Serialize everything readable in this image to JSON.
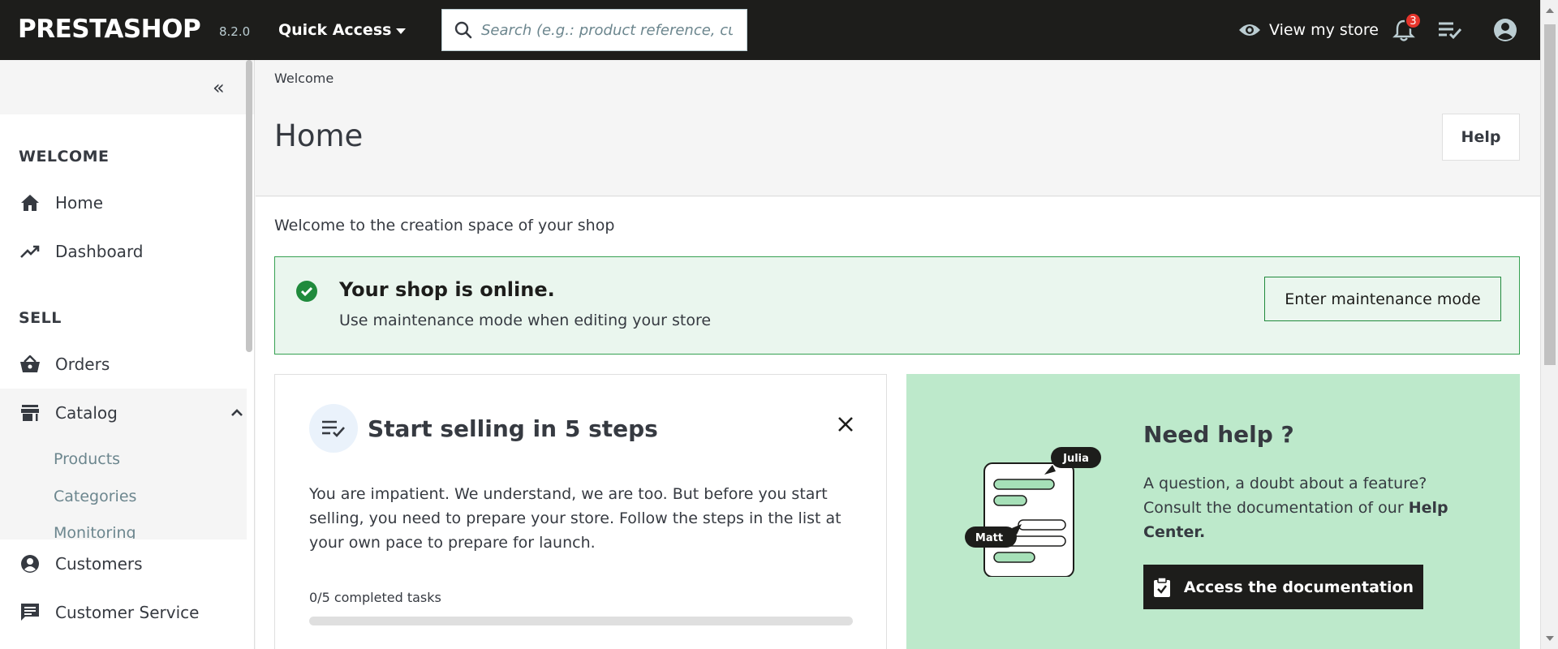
{
  "topbar": {
    "logo": "PRESTASHOP",
    "version": "8.2.0",
    "quick_access": "Quick Access",
    "search_placeholder": "Search (e.g.: product reference, custon",
    "view_store": "View my store",
    "notifications_count": "3"
  },
  "sidebar": {
    "sections": [
      {
        "title": "WELCOME"
      },
      {
        "title": "SELL"
      }
    ],
    "items": [
      {
        "label": "Home",
        "icon": "home-icon"
      },
      {
        "label": "Dashboard",
        "icon": "trending-up-icon"
      },
      {
        "label": "Orders",
        "icon": "basket-icon"
      },
      {
        "label": "Catalog",
        "icon": "store-icon"
      },
      {
        "label": "Customers",
        "icon": "account-circle-icon"
      },
      {
        "label": "Customer Service",
        "icon": "chat-icon"
      }
    ],
    "catalog_sub": [
      "Products",
      "Categories",
      "Monitoring"
    ]
  },
  "header": {
    "breadcrumb": "Welcome",
    "title": "Home",
    "help_button": "Help"
  },
  "content": {
    "welcome_text": "Welcome to the creation space of your shop",
    "online": {
      "title": "Your shop is online.",
      "subtitle": "Use maintenance mode when editing your store",
      "button": "Enter maintenance mode"
    },
    "steps": {
      "title": "Start selling in 5 steps",
      "description": "You are impatient. We understand, we are too. But before you start selling, you need to prepare your store. Follow the steps in the list at your own pace to prepare for launch.",
      "progress_label": "0/5 completed tasks",
      "progress_fraction": 0
    },
    "help": {
      "title": "Need help ?",
      "desc_prefix": "A question, a doubt about a feature? Consult the documentation of our ",
      "desc_bold": "Help Center.",
      "button": "Access the documentation",
      "bubble_a": "Julia",
      "bubble_b": "Matt"
    }
  },
  "colors": {
    "topbar": "#1d1d1b",
    "success": "#208a3c",
    "help_card": "#bde9cb",
    "badge": "#e6342b"
  }
}
